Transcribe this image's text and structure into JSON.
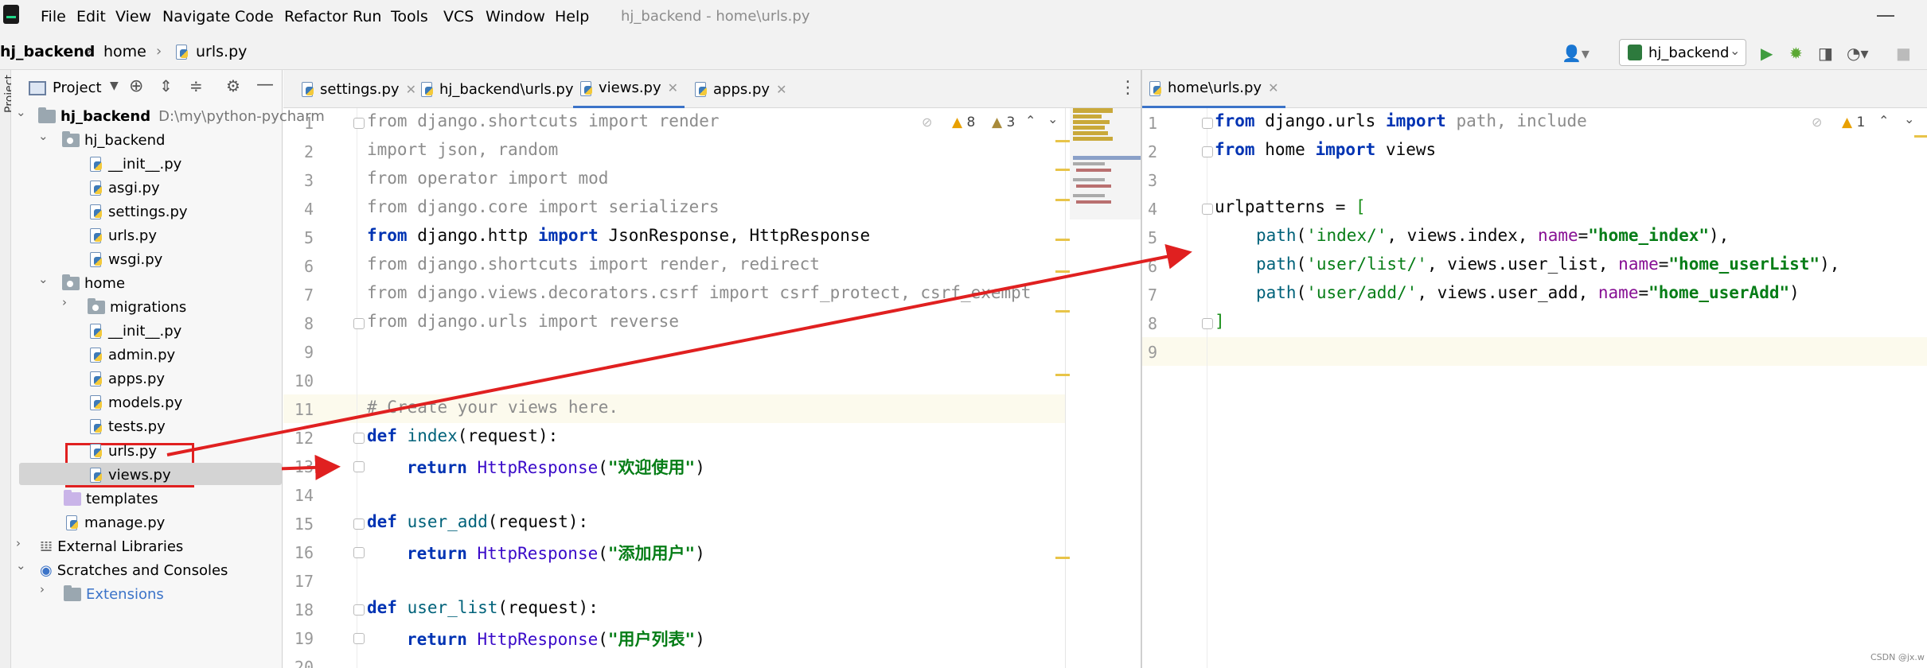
{
  "menubar": {
    "items": [
      "File",
      "Edit",
      "View",
      "Navigate",
      "Code",
      "Refactor",
      "Run",
      "Tools",
      "VCS",
      "Window",
      "Help"
    ],
    "window_title": "hj_backend - home\\urls.py"
  },
  "navbar": {
    "project": "hj_backend",
    "folder": "home",
    "file": "urls.py",
    "run_config": "hj_backend"
  },
  "project_panel": {
    "title": "Project",
    "vertical_label": "Project",
    "tree": {
      "root_name": "hj_backend",
      "root_path": "D:\\my\\python-pycharm",
      "pkg1": "hj_backend",
      "pkg1_files": [
        "__init__.py",
        "asgi.py",
        "settings.py",
        "urls.py",
        "wsgi.py"
      ],
      "pkg2": "home",
      "migrations": "migrations",
      "pkg2_files": [
        "__init__.py",
        "admin.py",
        "apps.py",
        "models.py",
        "tests.py",
        "urls.py",
        "views.py"
      ],
      "templates": "templates",
      "manage": "manage.py",
      "external": "External Libraries",
      "scratches": "Scratches and Consoles",
      "extensions": "Extensions"
    }
  },
  "left_editor": {
    "tabs": [
      "settings.py",
      "hj_backend\\urls.py",
      "views.py",
      "apps.py"
    ],
    "active_tab": "views.py",
    "warnings": "8",
    "weak_warnings": "3",
    "line_numbers": [
      "1",
      "2",
      "3",
      "4",
      "5",
      "6",
      "7",
      "8",
      "9",
      "10",
      "11",
      "12",
      "13",
      "14",
      "15",
      "16",
      "17",
      "18",
      "19",
      "20"
    ],
    "code": {
      "l1": [
        "from",
        " django.shortcuts ",
        "import",
        " render"
      ],
      "l2": [
        "import",
        " json, random"
      ],
      "l3": [
        "from",
        " operator ",
        "import",
        " mod"
      ],
      "l4": [
        "from",
        " django.core ",
        "import",
        " serializers"
      ],
      "l5": [
        "from",
        " django.http ",
        "import",
        " JsonResponse, HttpResponse"
      ],
      "l6": [
        "from",
        " django.shortcuts ",
        "import",
        " render, redirect"
      ],
      "l7": [
        "from",
        " django.views.decorators.csrf ",
        "import",
        " csrf_protect, csrf_exempt"
      ],
      "l8": [
        "from",
        " django.urls ",
        "import",
        " reverse"
      ],
      "l11": "# Create your views here.",
      "l12": [
        "def",
        " index",
        "(",
        "request",
        "):"
      ],
      "l13": [
        "return",
        " ",
        "HttpResponse",
        "(",
        "\"欢迎使用\"",
        ")"
      ],
      "l15": [
        "def",
        " user_add",
        "(",
        "request",
        "):"
      ],
      "l16": [
        "return",
        " ",
        "HttpResponse",
        "(",
        "\"添加用户\"",
        ")"
      ],
      "l18": [
        "def",
        " user_list",
        "(",
        "request",
        "):"
      ],
      "l19": [
        "return",
        " ",
        "HttpResponse",
        "(",
        "\"用户列表\"",
        ")"
      ]
    }
  },
  "right_editor": {
    "tab": "home\\urls.py",
    "warnings": "1",
    "line_numbers": [
      "1",
      "2",
      "3",
      "4",
      "5",
      "6",
      "7",
      "8",
      "9"
    ],
    "code": {
      "l1": [
        "from",
        " django.urls ",
        "import",
        " path, include"
      ],
      "l2": [
        "from",
        " home ",
        "import",
        " views"
      ],
      "l4": [
        "urlpatterns = ",
        "["
      ],
      "l5": [
        "path",
        "(",
        "'index/'",
        ", views.index, ",
        "name",
        "=",
        "\"home_index\"",
        "),"
      ],
      "l6": [
        "path",
        "(",
        "'user/list/'",
        ", views.user_list, ",
        "name",
        "=",
        "\"home_userList\"",
        "),"
      ],
      "l7": [
        "path",
        "(",
        "'user/add/'",
        ", views.user_add, ",
        "name",
        "=",
        "\"home_userAdd\"",
        ")"
      ],
      "l8": "]"
    }
  },
  "watermark": "CSDN @jx.w",
  "colors": {
    "annotation_red": "#e02020",
    "keyword": "#0033b3",
    "string": "#067d17",
    "current_line": "#fcfaed"
  }
}
